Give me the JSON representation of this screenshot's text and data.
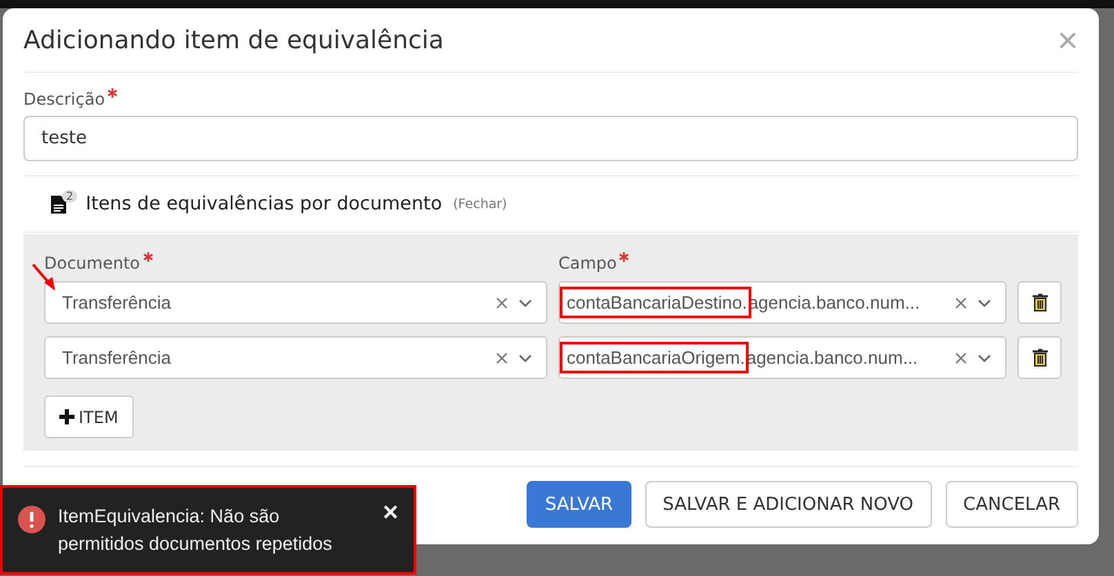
{
  "dialog": {
    "title": "Adicionando item de equivalência",
    "close": "×"
  },
  "description": {
    "label": "Descrição",
    "required": true,
    "value": "teste"
  },
  "section": {
    "badge": "2",
    "title": "Itens de equivalências por documento",
    "toggle": "(Fechar)"
  },
  "columns": [
    {
      "label": "Documento",
      "required": true
    },
    {
      "label": "Campo",
      "required": true
    }
  ],
  "rows": [
    {
      "document": "Transferência",
      "arrow": true,
      "field_highlight": "contaBancariaDestino.",
      "field_rest": "agencia.banco.num..."
    },
    {
      "document": "Transferência",
      "arrow": false,
      "field_highlight": "contaBancariaOrigem.",
      "field_rest": "agencia.banco.num..."
    }
  ],
  "add_button": "ITEM",
  "buttons": [
    {
      "label": "SALVAR",
      "kind": "primary"
    },
    {
      "label": "SALVAR E ADICIONAR NOVO",
      "kind": "default"
    },
    {
      "label": "CANCELAR",
      "kind": "default"
    }
  ],
  "toast": {
    "message": "ItemEquivalencia: Não são permitidos documentos repetidos",
    "close": "✕",
    "highlighted": true
  }
}
